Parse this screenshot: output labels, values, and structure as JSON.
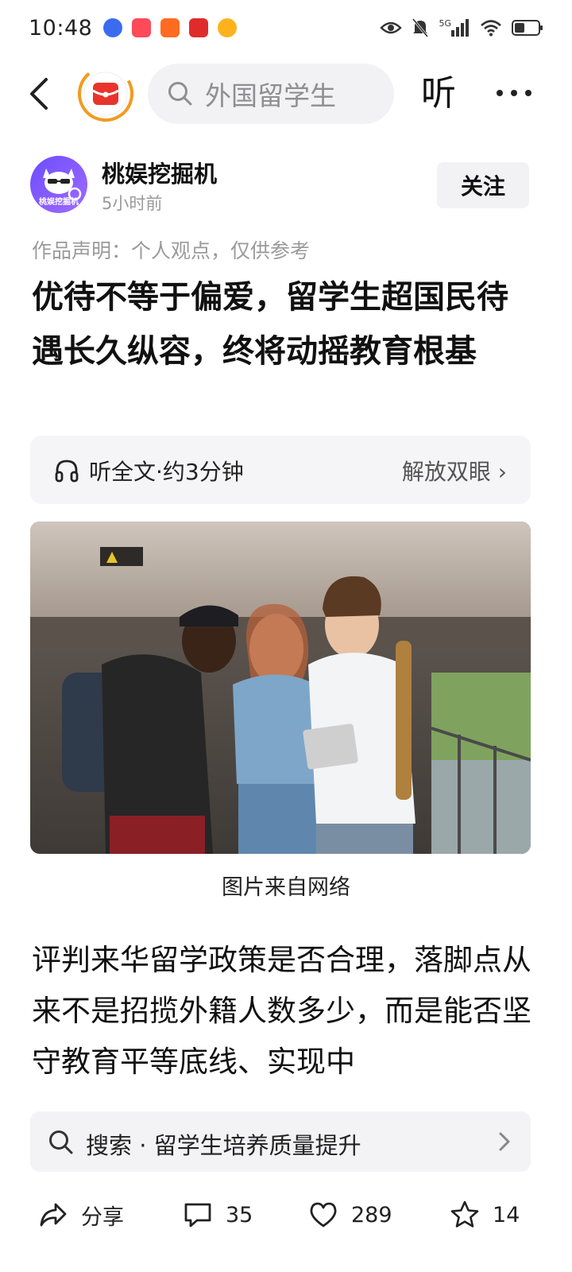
{
  "status": {
    "time": "10:48",
    "network": "5G"
  },
  "topbar": {
    "search_text": "外国留学生",
    "listen_label": "听"
  },
  "author": {
    "name": "桃娱挖掘机",
    "time": "5小时前",
    "avatar_text": "桃娱挖掘机",
    "follow_label": "关注"
  },
  "article": {
    "statement": "作品声明：个人观点，仅供参考",
    "headline": "优待不等于偏爱，留学生超国民待遇长久纵容，终将动摇教育根基",
    "listen_label": "听全文·约3分钟",
    "listen_action": "解放双眼 ›",
    "image_caption": "图片来自网络",
    "body": "评判来华留学政策是否合理，落脚点从来不是招揽外籍人数多少，而是能否坚守教育平等底线、实现中"
  },
  "suggest": {
    "text": "搜索 · 留学生培养质量提升"
  },
  "actions": {
    "share_label": "分享",
    "comment_count": "35",
    "like_count": "289",
    "favorite_count": "14"
  },
  "colors": {
    "accent_red": "#e8342c",
    "accent_orange": "#f39a1e",
    "card_bg": "#f5f5f7",
    "muted_text": "#9a9a9a"
  }
}
